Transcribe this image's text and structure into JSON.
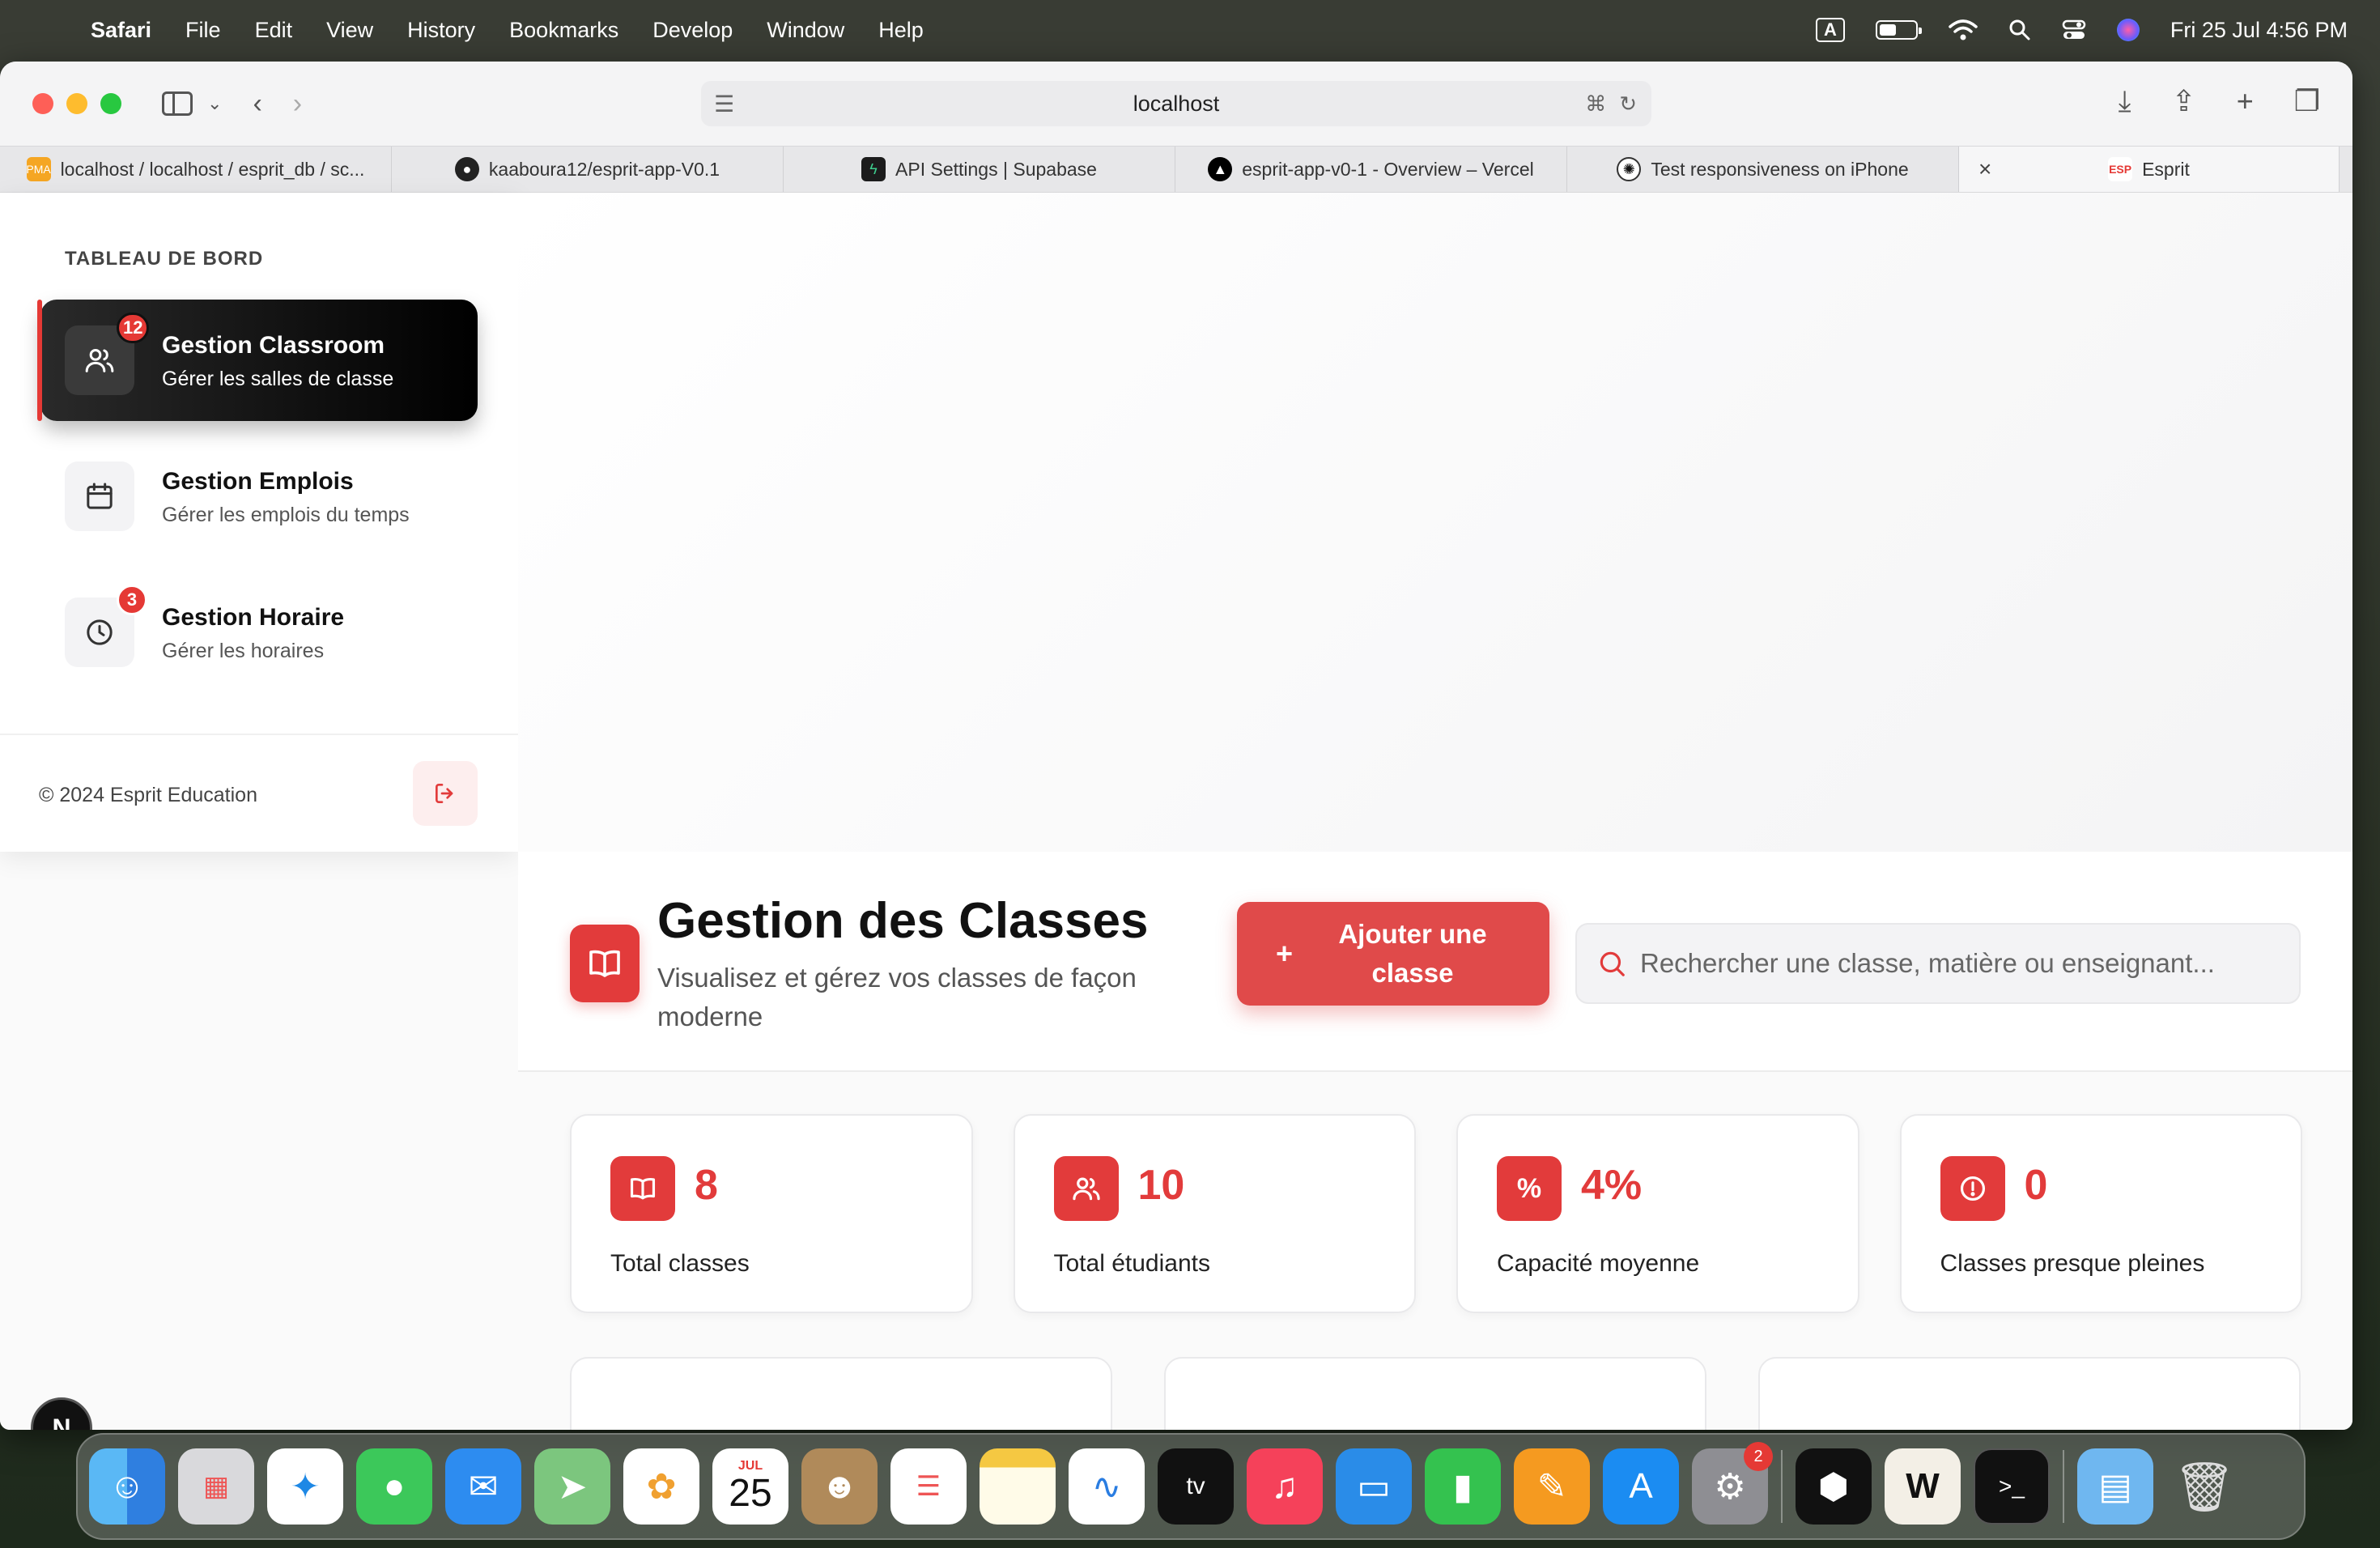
{
  "menubar": {
    "app": "Safari",
    "items": [
      "File",
      "Edit",
      "View",
      "History",
      "Bookmarks",
      "Develop",
      "Window",
      "Help"
    ],
    "input_indicator": "A",
    "datetime": "Fri 25 Jul  4:56 PM"
  },
  "browser": {
    "url": "localhost",
    "tabs": [
      {
        "label": "localhost / localhost / esprit_db / sc...",
        "icon": "phpmyadmin-icon"
      },
      {
        "label": "kaaboura12/esprit-app-V0.1",
        "icon": "github-icon"
      },
      {
        "label": "API Settings | Supabase",
        "icon": "supabase-icon"
      },
      {
        "label": "esprit-app-v0-1 - Overview – Vercel",
        "icon": "vercel-icon"
      },
      {
        "label": "Test responsiveness on iPhone",
        "icon": "openai-icon"
      },
      {
        "label": "Esprit",
        "icon": "esprit-icon"
      }
    ]
  },
  "sidebar": {
    "heading": "TABLEAU DE BORD",
    "items": [
      {
        "title": "Gestion Classroom",
        "subtitle": "Gérer les salles de classe",
        "badge": "12",
        "icon": "users-icon"
      },
      {
        "title": "Gestion Emplois",
        "subtitle": "Gérer les emplois du temps",
        "badge": "",
        "icon": "calendar-icon"
      },
      {
        "title": "Gestion Horaire",
        "subtitle": "Gérer les horaires",
        "badge": "3",
        "icon": "clock-icon"
      }
    ],
    "footer": "© 2024 Esprit Education"
  },
  "header": {
    "title": "Gestion des Classes",
    "subtitle": "Visualisez et gérez vos classes de façon moderne",
    "add_button": "Ajouter une classe",
    "search_placeholder": "Rechercher une classe, matière ou enseignant..."
  },
  "stats": [
    {
      "value": "8",
      "label": "Total classes",
      "icon": "book-icon"
    },
    {
      "value": "10",
      "label": "Total étudiants",
      "icon": "users-icon"
    },
    {
      "value": "4%",
      "label": "Capacité moyenne",
      "icon": "percent-icon"
    },
    {
      "value": "0",
      "label": "Classes presque pleines",
      "icon": "alert-icon"
    }
  ],
  "dev_indicator": "N",
  "dock": {
    "calendar_month": "JUL",
    "calendar_day": "25",
    "settings_badge": "2"
  },
  "colors": {
    "accent": "#e23b3b",
    "nav_active": "#000000"
  }
}
